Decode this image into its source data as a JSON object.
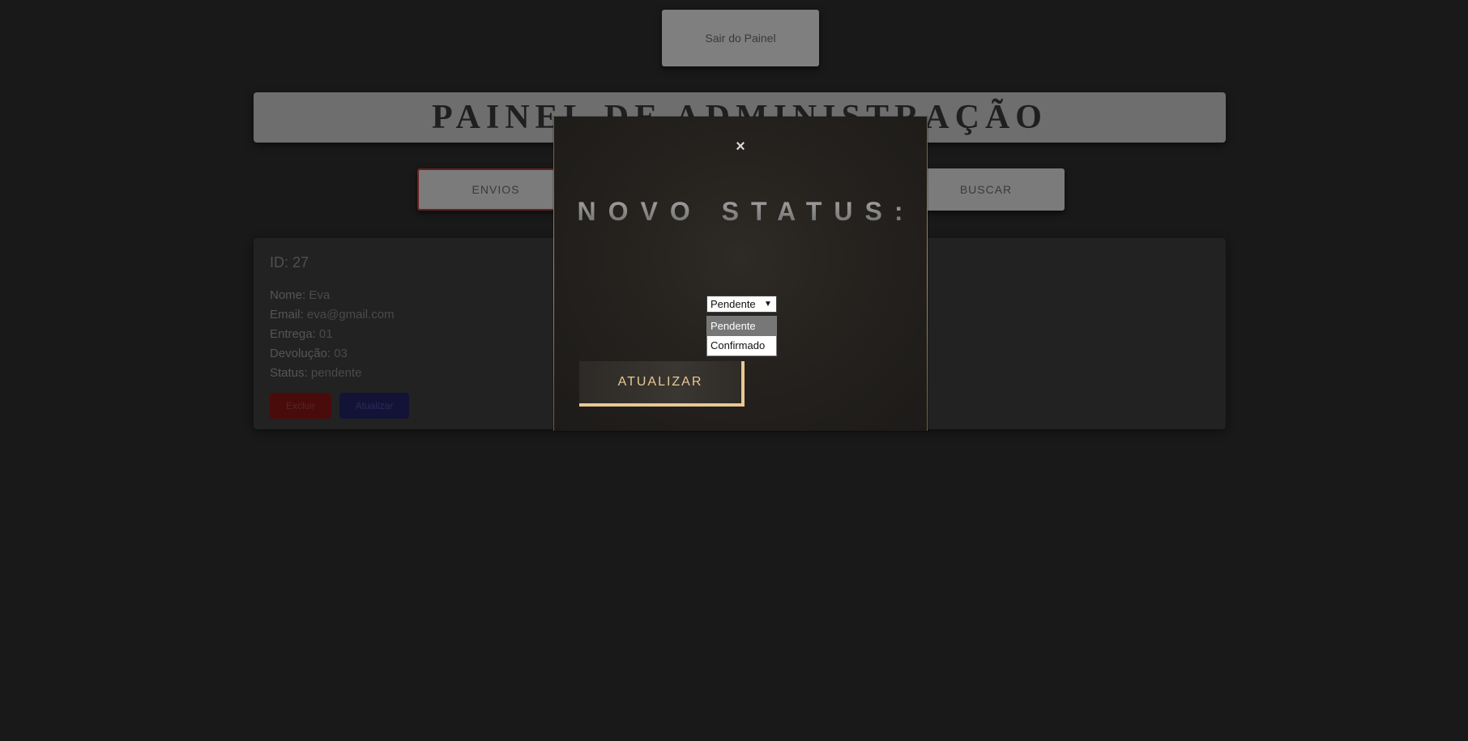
{
  "background_page": {
    "top_button_label": "Sair do Painel",
    "admin_title": "PAINEL DE ADMINISTRAÇÃO",
    "nav": {
      "left_label": "ENVIOS",
      "right_label": "BUSCAR"
    },
    "card": {
      "id": "ID: 27",
      "fields": [
        {
          "key": "Nome:",
          "value": "Eva"
        },
        {
          "key": "Email:",
          "value": "eva@gmail.com"
        },
        {
          "key": "Entrega:",
          "value": "01"
        },
        {
          "key": "Devolução:",
          "value": "03"
        },
        {
          "key": "Status:",
          "value": "pendente"
        }
      ],
      "delete_label": "Excluir",
      "update_label": "Atualizar"
    }
  },
  "modal": {
    "close_glyph": "×",
    "title": "NOVO STATUS:",
    "select": {
      "current_value": "Pendente",
      "options": [
        "Pendente",
        "Confirmado"
      ]
    },
    "submit_label": "ATUALIZAR"
  },
  "colors": {
    "page_background": "#191919",
    "accent_gold": "#e9c892",
    "modal_background": "#2a2622"
  }
}
